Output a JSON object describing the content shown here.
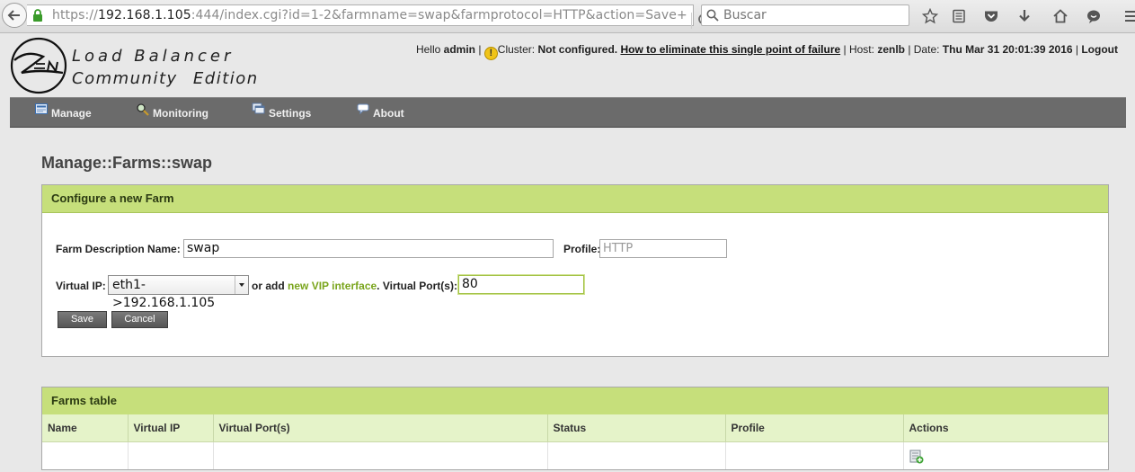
{
  "browser": {
    "url_prefix": "https://",
    "url_host": "192.168.1.105",
    "url_rest": ":444/index.cgi?id=1-2&farmname=swap&farmprotocol=HTTP&action=Save+",
    "search_placeholder": "Buscar"
  },
  "brand": {
    "line1": "Load Balancer",
    "line2": "Community Edition"
  },
  "status": {
    "hello_prefix": "Hello ",
    "user": "admin",
    "sep1": " | ",
    "cluster_label": "Cluster: ",
    "cluster_value": "Not configured.",
    "cluster_link": "How to eliminate this single point of failure",
    "host_label": " | Host: ",
    "host_value": "zenlb",
    "date_label": " | Date: ",
    "date_value": "Thu Mar 31 20:01:39 2016",
    "sep2": " | ",
    "logout": "Logout"
  },
  "nav": {
    "manage": "Manage",
    "monitoring": "Monitoring",
    "settings": "Settings",
    "about": "About"
  },
  "page_title": "Manage::Farms::swap",
  "new_farm": {
    "header": "Configure a new Farm",
    "desc_label": "Farm Description Name:",
    "desc_value": "swap",
    "profile_label": "Profile:",
    "profile_placeholder": "HTTP",
    "vip_label": "Virtual IP:",
    "vip_selected": "eth1->192.168.1.105",
    "or_add": "or add",
    "new_vip_link": "new VIP interface",
    "port_label": ". Virtual Port(s):",
    "port_value": "80",
    "save": "Save",
    "cancel": "Cancel"
  },
  "farms_table": {
    "header": "Farms table",
    "columns": [
      "Name",
      "Virtual IP",
      "Virtual Port(s)",
      "Status",
      "Profile",
      "Actions"
    ]
  },
  "colors": {
    "box_header": "#c6df7b",
    "table_header": "#e5f3c9",
    "navbar": "#6b6b6b",
    "link_green": "#7aa51d"
  }
}
